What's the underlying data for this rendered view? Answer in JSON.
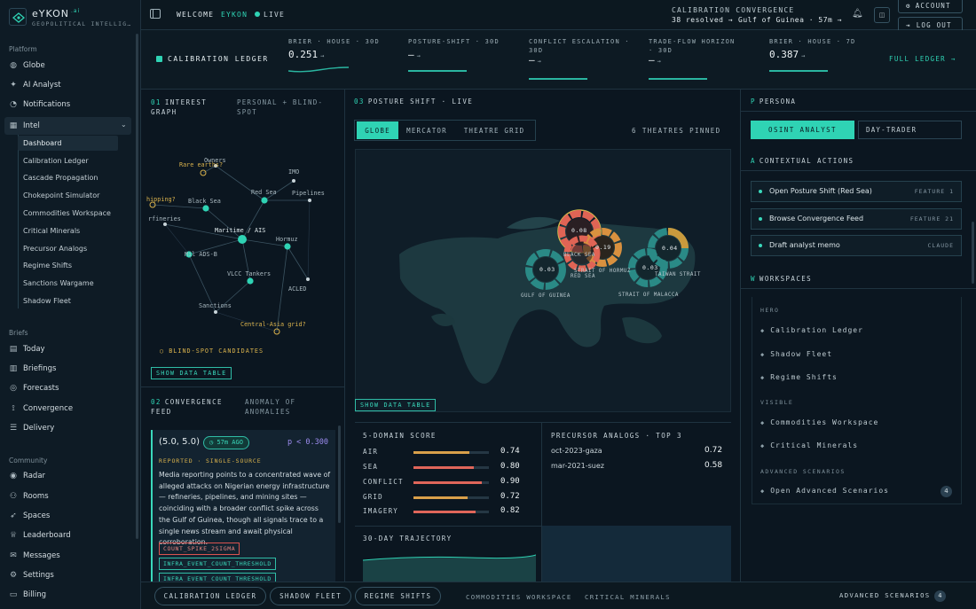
{
  "app": {
    "name": "eYKON",
    "name_suffix": ".ai",
    "tagline": "GEOPOLITICAL INTELLIG…"
  },
  "sidebar": {
    "platform_label": "Platform",
    "platform": [
      {
        "label": "Globe",
        "icon": "globe-icon"
      },
      {
        "label": "AI Analyst",
        "icon": "sparkle-icon"
      },
      {
        "label": "Notifications",
        "icon": "bell-icon"
      }
    ],
    "intel": {
      "label": "Intel",
      "icon": "grid-icon"
    },
    "intel_items": [
      "Dashboard",
      "Calibration Ledger",
      "Cascade Propagation",
      "Chokepoint Simulator",
      "Commodities Workspace",
      "Critical Minerals",
      "Precursor Analogs",
      "Regime Shifts",
      "Sanctions Wargame",
      "Shadow Fleet"
    ],
    "intel_active": "Dashboard",
    "briefs_label": "Briefs",
    "briefs": [
      {
        "label": "Today",
        "icon": "calendar-icon"
      },
      {
        "label": "Briefings",
        "icon": "document-icon"
      },
      {
        "label": "Forecasts",
        "icon": "target-icon"
      },
      {
        "label": "Convergence",
        "icon": "convergence-icon"
      },
      {
        "label": "Delivery",
        "icon": "list-icon"
      }
    ],
    "community_label": "Community",
    "community": [
      {
        "label": "Radar",
        "icon": "radar-icon"
      },
      {
        "label": "Rooms",
        "icon": "people-icon"
      },
      {
        "label": "Spaces",
        "icon": "rocket-icon"
      },
      {
        "label": "Leaderboard",
        "icon": "trophy-icon"
      },
      {
        "label": "Messages",
        "icon": "mail-icon"
      },
      {
        "label": "Settings",
        "icon": "gear-icon"
      },
      {
        "label": "Billing",
        "icon": "card-icon"
      }
    ]
  },
  "topbar": {
    "welcome": "WELCOME",
    "user": "EYKON",
    "live": "LIVE",
    "calib_line1": "CALIBRATION  CONVERGENCE",
    "calib_resolved": "38 resolved →",
    "calib_region": "Gulf of Guinea · 57m →",
    "account": "ACCOUNT",
    "logout": "LOG OUT"
  },
  "ledger": {
    "title": "CALIBRATION LEDGER",
    "full_link": "FULL LEDGER →",
    "metrics": [
      {
        "label": "BRIER · HOUSE · 30D",
        "value": "0.251"
      },
      {
        "label": "POSTURE-SHIFT · 30D",
        "value": "—"
      },
      {
        "label": "CONFLICT ESCALATION · 30D",
        "value": "—"
      },
      {
        "label": "TRADE-FLOW HORIZON · 30D",
        "value": "—"
      },
      {
        "label": "BRIER · HOUSE · 7D",
        "value": "0.387"
      }
    ]
  },
  "interest_graph": {
    "num": "01",
    "title": "INTEREST GRAPH",
    "subtitle": "PERSONAL + BLIND-SPOT",
    "nodes": [
      "Rare earths?",
      "Owners",
      "IMO",
      "Red Sea",
      "Pipelines",
      "Black Sea",
      "hipping?",
      "rfineries",
      "Maritime / AIS",
      "Hormuz",
      "Mil ADS-B",
      "VLCC Tankers",
      "ACLED",
      "Sanctions",
      "Central-Asia grid?"
    ],
    "legend": "BLIND-SPOT CANDIDATES",
    "show_table": "SHOW DATA TABLE"
  },
  "convergence_feed": {
    "num": "02",
    "title": "CONVERGENCE FEED",
    "subtitle": "ANOMALY OF ANOMALIES",
    "card": {
      "score": "(5.0, 5.0)",
      "age": "57m AGO",
      "p": "p < 0.300",
      "meta": "REPORTED · SINGLE-SOURCE",
      "body": "Media reporting points to a concentrated wave of alleged attacks on Nigerian energy infrastructure — refineries, pipelines, and mining sites — coinciding with a broader conflict spike across the Gulf of Guinea, though all signals trace to a single news stream and await physical corroboration.",
      "tags": [
        "COUNT_SPIKE_2SIGMA",
        "INFRA_EVENT_COUNT_THRESHOLD",
        "INFRA_EVENT_COUNT_THRESHOLD"
      ]
    }
  },
  "posture": {
    "num": "03",
    "title": "POSTURE SHIFT · LIVE",
    "tabs": [
      "GLOBE",
      "MERCATOR",
      "THEATRE GRID"
    ],
    "active_tab": "GLOBE",
    "pinned": "6 THEATRES PINNED",
    "theatres": [
      {
        "label": "GULF OF GUINEA",
        "value": "0.03"
      },
      {
        "label": "BLACK SEA",
        "value": "0.08"
      },
      {
        "label": "STRAIT OF HORMUZ",
        "value": "0.19"
      },
      {
        "label": "RED SEA",
        "value": ""
      },
      {
        "label": "STRAIT OF MALACCA",
        "value": "0.03"
      },
      {
        "label": "TAIWAN STRAIT",
        "value": "0.04"
      }
    ],
    "show_table": "SHOW DATA TABLE"
  },
  "five_domain": {
    "title": "5-DOMAIN SCORE",
    "rows": [
      {
        "name": "AIR",
        "value": "0.74",
        "level": 0.74,
        "color": "#d9a04a"
      },
      {
        "name": "SEA",
        "value": "0.80",
        "level": 0.8,
        "color": "#e0665a"
      },
      {
        "name": "CONFLICT",
        "value": "0.90",
        "level": 0.9,
        "color": "#e0665a"
      },
      {
        "name": "GRID",
        "value": "0.72",
        "level": 0.72,
        "color": "#d9a04a"
      },
      {
        "name": "IMAGERY",
        "value": "0.82",
        "level": 0.82,
        "color": "#e0665a"
      }
    ]
  },
  "precursor": {
    "title": "PRECURSOR ANALOGS · TOP 3",
    "rows": [
      {
        "name": "oct-2023-gaza",
        "value": "0.72"
      },
      {
        "name": "mar-2021-suez",
        "value": "0.58"
      }
    ]
  },
  "trajectory": {
    "title": "30-DAY TRAJECTORY"
  },
  "persona": {
    "letter": "P",
    "title": "PERSONA",
    "options": [
      "OSINT ANALYST",
      "DAY-TRADER"
    ],
    "active": "OSINT ANALYST",
    "actions_letter": "A",
    "actions_title": "CONTEXTUAL ACTIONS",
    "actions": [
      {
        "label": "Open Posture Shift (Red Sea)",
        "right": "FEATURE 1"
      },
      {
        "label": "Browse Convergence Feed",
        "right": "FEATURE 21"
      },
      {
        "label": "Draft analyst memo",
        "right": "CLAUDE"
      }
    ],
    "workspaces_letter": "W",
    "workspaces_title": "WORKSPACES",
    "hero_label": "HERO",
    "hero": [
      "Calibration Ledger",
      "Shadow Fleet",
      "Regime Shifts"
    ],
    "visible_label": "VISIBLE",
    "visible": [
      "Commodities Workspace",
      "Critical Minerals"
    ],
    "advanced_label": "ADVANCED SCENARIOS",
    "advanced_item": "Open Advanced Scenarios",
    "advanced_count": "4"
  },
  "bottombar": {
    "pills": [
      "CALIBRATION LEDGER",
      "SHADOW FLEET",
      "REGIME SHIFTS"
    ],
    "links": [
      "COMMODITIES WORKSPACE",
      "CRITICAL MINERALS"
    ],
    "advanced": "ADVANCED SCENARIOS",
    "advanced_count": "4"
  },
  "colors": {
    "accent": "#2fd3b4",
    "warn": "#d9b24c",
    "danger": "#e0665a",
    "bg": "#0b1620"
  }
}
